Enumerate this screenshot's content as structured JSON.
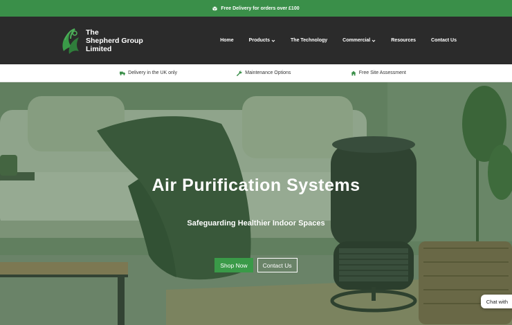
{
  "promo": {
    "icon": "package-icon",
    "text": "Free Delivery for orders over £100"
  },
  "brand": {
    "line1": "The",
    "line2": "Shepherd Group",
    "line3": "Limited"
  },
  "nav": {
    "home": "Home",
    "products": "Products",
    "technology": "The Technology",
    "commercial": "Commercial",
    "resources": "Resources",
    "contact": "Contact Us"
  },
  "usps": {
    "delivery": "Delivery in the UK only",
    "maintenance": "Maintenance Options",
    "assessment": "Free Site Assessment"
  },
  "hero": {
    "title": "Air Purification Systems",
    "subtitle": "Safeguarding Healthier Indoor Spaces",
    "shop_label": "Shop Now",
    "contact_label": "Contact Us"
  },
  "chat": {
    "label": "Chat with"
  },
  "colors": {
    "accent": "#3a8f49",
    "header_bg": "#2b2b2b"
  }
}
